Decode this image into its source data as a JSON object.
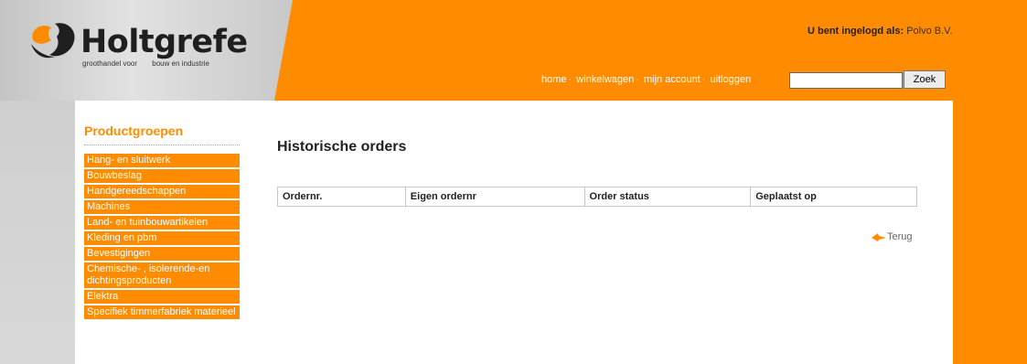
{
  "logo": {
    "name": "Holtgrefe",
    "tagline": [
      "groothandel voor",
      "bouw en industrie"
    ]
  },
  "header": {
    "login_label": "U bent ingelogd als:",
    "login_user": "Polvo B.V.",
    "nav": [
      "home",
      "winkelwagen",
      "mijn account",
      "uitloggen"
    ],
    "search": {
      "value": "",
      "button_label": "Zoek"
    }
  },
  "sidebar": {
    "title": "Productgroepen",
    "items": [
      "Hang- en sluitwerk",
      "Bouwbeslag",
      "Handgereedschappen",
      "Machines",
      "Land- en tuinbouwartikelen",
      "Kleding en pbm",
      "Bevestigingen",
      "Chemische- , isolerende-en dichtingsproducten",
      "Elektra",
      "Specifiek timmerfabriek materieel"
    ]
  },
  "main": {
    "title": "Historische orders",
    "table_headers": [
      "Ordernr.",
      "Eigen ordernr",
      "Order status",
      "Geplaatst op"
    ],
    "back_label": "Terug"
  },
  "colors": {
    "accent": "#ff8c00",
    "grey": "#d2d2d2"
  },
  "icons": {
    "logo": "logo-mark-icon",
    "back": "back-arrow-icon"
  }
}
